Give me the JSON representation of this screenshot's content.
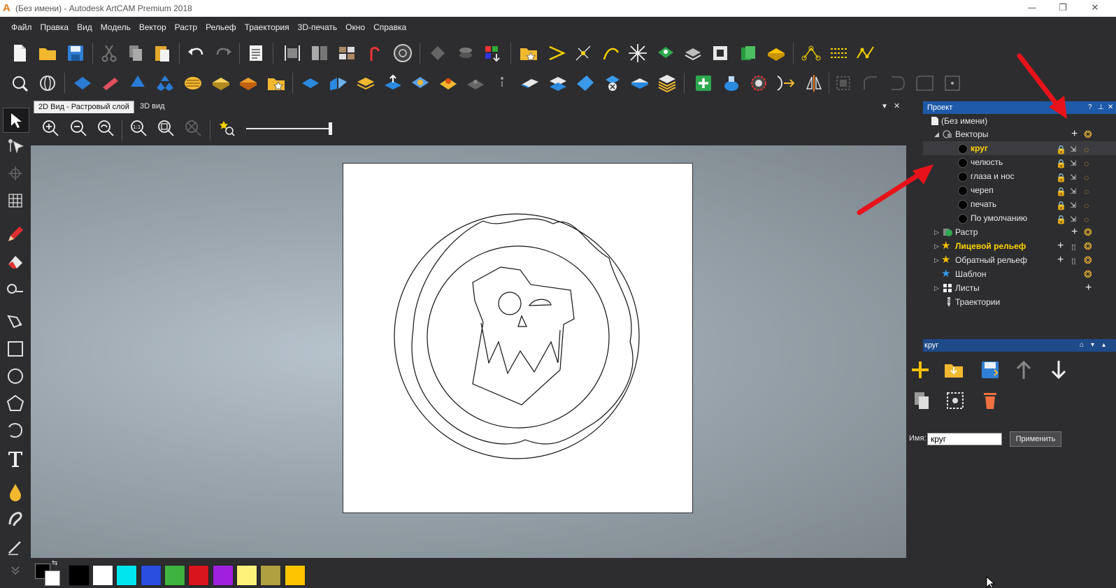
{
  "window": {
    "title": "(Без имени) - Autodesk ArtCAM Premium 2018",
    "app_icon_letter": "A",
    "minimize": "—",
    "restore": "❐",
    "close": "✕"
  },
  "menu": [
    "Файл",
    "Правка",
    "Вид",
    "Модель",
    "Вектор",
    "Растр",
    "Рельеф",
    "Траектория",
    "3D-печать",
    "Окно",
    "Справка"
  ],
  "view_tabs": [
    {
      "label": "2D Вид - Растровый слой",
      "active": true
    },
    {
      "label": "3D вид",
      "active": false
    }
  ],
  "project_panel": {
    "title": "Проект",
    "help": "?",
    "pin": "⊥",
    "close": "✕",
    "tree": {
      "root": "(Без имени)",
      "vectors_label": "Векторы",
      "vector_layers": [
        "круг",
        "челюсть",
        "глаза и нос",
        "череп",
        "печать",
        "По умолчанию"
      ],
      "selected_layer": "круг",
      "raster_label": "Растр",
      "front_relief_label": "Лицевой рельеф",
      "back_relief_label": "Обратный рельеф",
      "template_label": "Шаблон",
      "sheets_label": "Листы",
      "toolpaths_label": "Траектории"
    }
  },
  "layer_panel": {
    "title": "круг",
    "name_label": "Имя:",
    "name_value": "круг",
    "apply_label": "Применить"
  },
  "palette_colors": [
    "#000000",
    "#ffffff",
    "#00e5ee",
    "#2a4ee0",
    "#3fb33f",
    "#d8141c",
    "#a020e0",
    "#fff27a",
    "#b0a040",
    "#ffc400"
  ],
  "accent_colors": {
    "selection": "#1e5aa8",
    "highlight_text": "#ffd400",
    "annotation_arrow": "#e8131a"
  }
}
